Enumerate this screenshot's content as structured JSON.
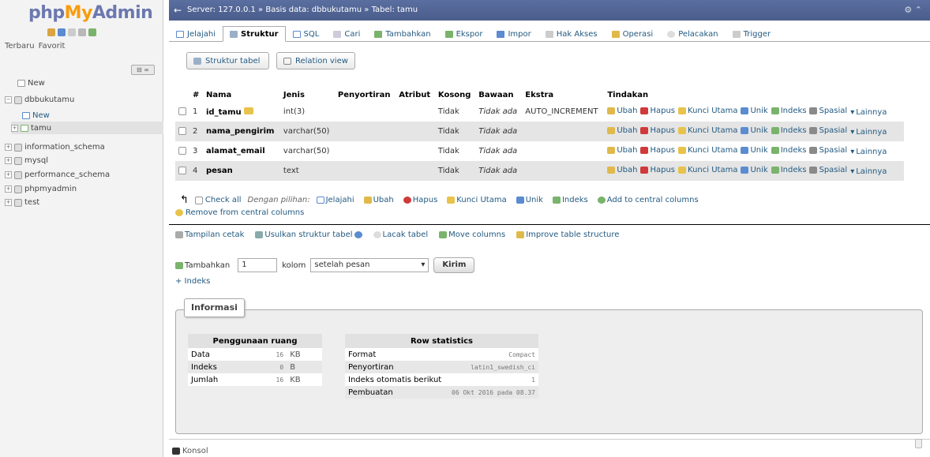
{
  "sidebar": {
    "logo_php": "php",
    "logo_my": "My",
    "logo_admin": "Admin",
    "tab_recent": "Terbaru",
    "tab_favorite": "Favorit",
    "link_button": "⊟ ∞",
    "items": [
      {
        "label": "New"
      },
      {
        "label": "dbbukutamu"
      },
      {
        "label": "New"
      },
      {
        "label": "tamu"
      },
      {
        "label": "information_schema"
      },
      {
        "label": "mysql"
      },
      {
        "label": "performance_schema"
      },
      {
        "label": "phpmyadmin"
      },
      {
        "label": "test"
      }
    ]
  },
  "topbar": {
    "breadcrumb": "Server: 127.0.0.1 » Basis data: dbbukutamu » Tabel: tamu",
    "right_icons": "⚙ ⌃"
  },
  "tabs": [
    {
      "label": "Jelajahi"
    },
    {
      "label": "Struktur"
    },
    {
      "label": "SQL"
    },
    {
      "label": "Cari"
    },
    {
      "label": "Tambahkan"
    },
    {
      "label": "Ekspor"
    },
    {
      "label": "Impor"
    },
    {
      "label": "Hak Akses"
    },
    {
      "label": "Operasi"
    },
    {
      "label": "Pelacakan"
    },
    {
      "label": "Trigger"
    }
  ],
  "subtabs": {
    "structure": "Struktur tabel",
    "relation": "Relation view"
  },
  "table": {
    "headers": {
      "num": "#",
      "name": "Nama",
      "type": "Jenis",
      "collation": "Penyortiran",
      "attributes": "Atribut",
      "null": "Kosong",
      "default": "Bawaan",
      "extra": "Ekstra",
      "actions": "Tindakan"
    },
    "rows": [
      {
        "num": "1",
        "name": "id_tamu",
        "type": "int(3)",
        "null": "Tidak",
        "default": "Tidak ada",
        "extra": "AUTO_INCREMENT"
      },
      {
        "num": "2",
        "name": "nama_pengirim",
        "type": "varchar(50)",
        "null": "Tidak",
        "default": "Tidak ada",
        "extra": ""
      },
      {
        "num": "3",
        "name": "alamat_email",
        "type": "varchar(50)",
        "null": "Tidak",
        "default": "Tidak ada",
        "extra": ""
      },
      {
        "num": "4",
        "name": "pesan",
        "type": "text",
        "null": "Tidak",
        "default": "Tidak ada",
        "extra": ""
      }
    ],
    "actions": {
      "edit": "Ubah",
      "drop": "Hapus",
      "primary": "Kunci Utama",
      "unique": "Unik",
      "index": "Indeks",
      "spatial": "Spasial",
      "more": "Lainnya"
    }
  },
  "bulk": {
    "check_all": "Check all",
    "with_selected": "Dengan pilihan:",
    "browse": "Jelajahi",
    "edit": "Ubah",
    "drop": "Hapus",
    "primary": "Kunci Utama",
    "unique": "Unik",
    "index": "Indeks",
    "add_central": "Add to central columns",
    "remove_central": "Remove from central columns"
  },
  "tools": {
    "print": "Tampilan cetak",
    "propose": "Usulkan struktur tabel",
    "track": "Lacak tabel",
    "move": "Move columns",
    "improve": "Improve table structure"
  },
  "add_columns": {
    "label": "Tambahkan",
    "count": "1",
    "unit": "kolom",
    "position": "setelah pesan",
    "go": "Kirim",
    "add_index": "+ Indeks"
  },
  "info": {
    "legend": "Informasi",
    "space_title": "Penggunaan ruang",
    "space_rows": [
      {
        "label": "Data",
        "value": "16",
        "unit": "KB"
      },
      {
        "label": "Indeks",
        "value": "0",
        "unit": "B"
      },
      {
        "label": "Jumlah",
        "value": "16",
        "unit": "KB"
      }
    ],
    "row_title": "Row statistics",
    "row_rows": [
      {
        "label": "Format",
        "value": "Compact"
      },
      {
        "label": "Penyortiran",
        "value": "latin1_swedish_ci"
      },
      {
        "label": "Indeks otomatis berikut",
        "value": "1"
      },
      {
        "label": "Pembuatan",
        "value": "06 Okt 2016 pada 08.37"
      }
    ]
  },
  "console": "Konsol",
  "colors": {
    "topbar": "#5a6ea0",
    "link": "#235a81",
    "row_alt": "#e5e5e5"
  }
}
